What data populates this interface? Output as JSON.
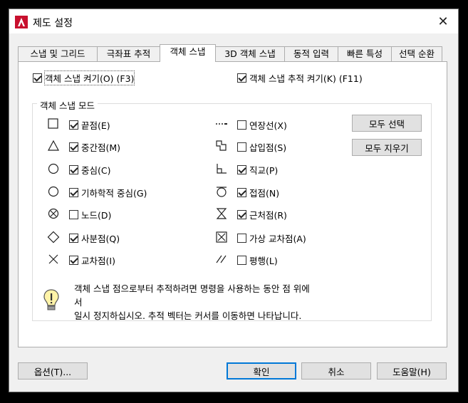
{
  "window": {
    "title": "제도 설정"
  },
  "tabs": [
    "스냅 및 그리드",
    "극좌표 추적",
    "객체 스냅",
    "3D 객체 스냅",
    "동적 입력",
    "빠른 특성",
    "선택 순환"
  ],
  "top_options": {
    "snap_on": {
      "label": "객체 스냅 켜기(O) (F3)",
      "checked": true
    },
    "tracking_on": {
      "label": "객체 스냅 추적 켜기(K) (F11)",
      "checked": true
    }
  },
  "modes": {
    "group_title": "객체 스냅 모드",
    "left": [
      {
        "label": "끝점(E)",
        "checked": true,
        "icon": "square-icon"
      },
      {
        "label": "중간점(M)",
        "checked": true,
        "icon": "triangle-icon"
      },
      {
        "label": "중심(C)",
        "checked": true,
        "icon": "circle-icon"
      },
      {
        "label": "기하학적 중심(G)",
        "checked": true,
        "icon": "circle-icon"
      },
      {
        "label": "노드(D)",
        "checked": false,
        "icon": "node-icon"
      },
      {
        "label": "사분점(Q)",
        "checked": true,
        "icon": "diamond-icon"
      },
      {
        "label": "교차점(I)",
        "checked": true,
        "icon": "x-icon"
      }
    ],
    "right": [
      {
        "label": "연장선(X)",
        "checked": false,
        "icon": "extension-icon"
      },
      {
        "label": "삽입점(S)",
        "checked": false,
        "icon": "insertion-icon"
      },
      {
        "label": "직교(P)",
        "checked": true,
        "icon": "perpendicular-icon"
      },
      {
        "label": "접점(N)",
        "checked": true,
        "icon": "tangent-icon"
      },
      {
        "label": "근처점(R)",
        "checked": true,
        "icon": "nearest-icon"
      },
      {
        "label": "가상 교차점(A)",
        "checked": false,
        "icon": "apparent-intersection-icon"
      },
      {
        "label": "평행(L)",
        "checked": false,
        "icon": "parallel-icon"
      }
    ],
    "select_all": "모두 선택",
    "clear_all": "모두 지우기"
  },
  "hint": {
    "line1": "객체 스냅 점으로부터 추적하려면 명령을 사용하는 동안 점 위에",
    "line2": "서",
    "line3": "일시 정지하십시오. 추적 벡터는 커서를 이동하면 나타납니다."
  },
  "footer": {
    "options": "옵션(T)...",
    "ok": "확인",
    "cancel": "취소",
    "help": "도움말(H)"
  },
  "colors": {
    "accent": "#0078d7",
    "app_icon": "#c8102e"
  }
}
